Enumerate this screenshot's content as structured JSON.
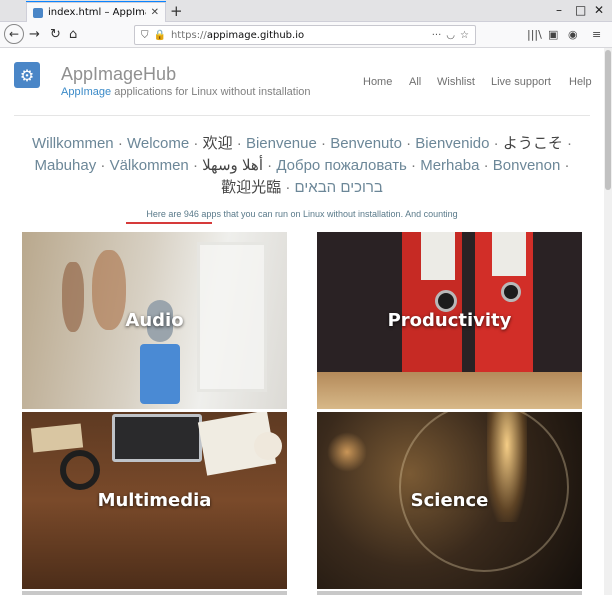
{
  "browser": {
    "tab_title": "index.html – AppImageHub",
    "new_tab": "+",
    "minimize": "–",
    "maximize": "□",
    "close": "✕",
    "url_scheme": "https://",
    "url_host": "appimage.github.io",
    "url_more": "···"
  },
  "site": {
    "title": "AppImageHub",
    "subtitle_brand": "AppImage",
    "subtitle_rest": " applications for Linux without installation",
    "nav": [
      "Home",
      "All",
      "Wishlist",
      "Live support",
      "Help"
    ]
  },
  "welcome": {
    "line1": [
      "Willkommen",
      "Welcome",
      "欢迎",
      "Bienvenue",
      "Benvenuto",
      "Bienvenido",
      "ようこそ"
    ],
    "line2": [
      "Mabuhay",
      "Välkommen",
      "أهلا وسهلا",
      "Добро пожаловать",
      "Merhaba",
      "Bonvenon"
    ],
    "line3": [
      "歡迎光臨",
      "ברוכים הבאים"
    ],
    "separator": "·"
  },
  "count": {
    "prefix": "Here are ",
    "apps": "946 apps",
    "suffix": " that you can run on Linux without installation. And counting"
  },
  "categories": [
    "Audio",
    "Productivity",
    "Multimedia",
    "Science"
  ],
  "colors": {
    "accent": "#0a84ff",
    "brand": "#3a8ac8",
    "underline": "#d63a3a"
  }
}
